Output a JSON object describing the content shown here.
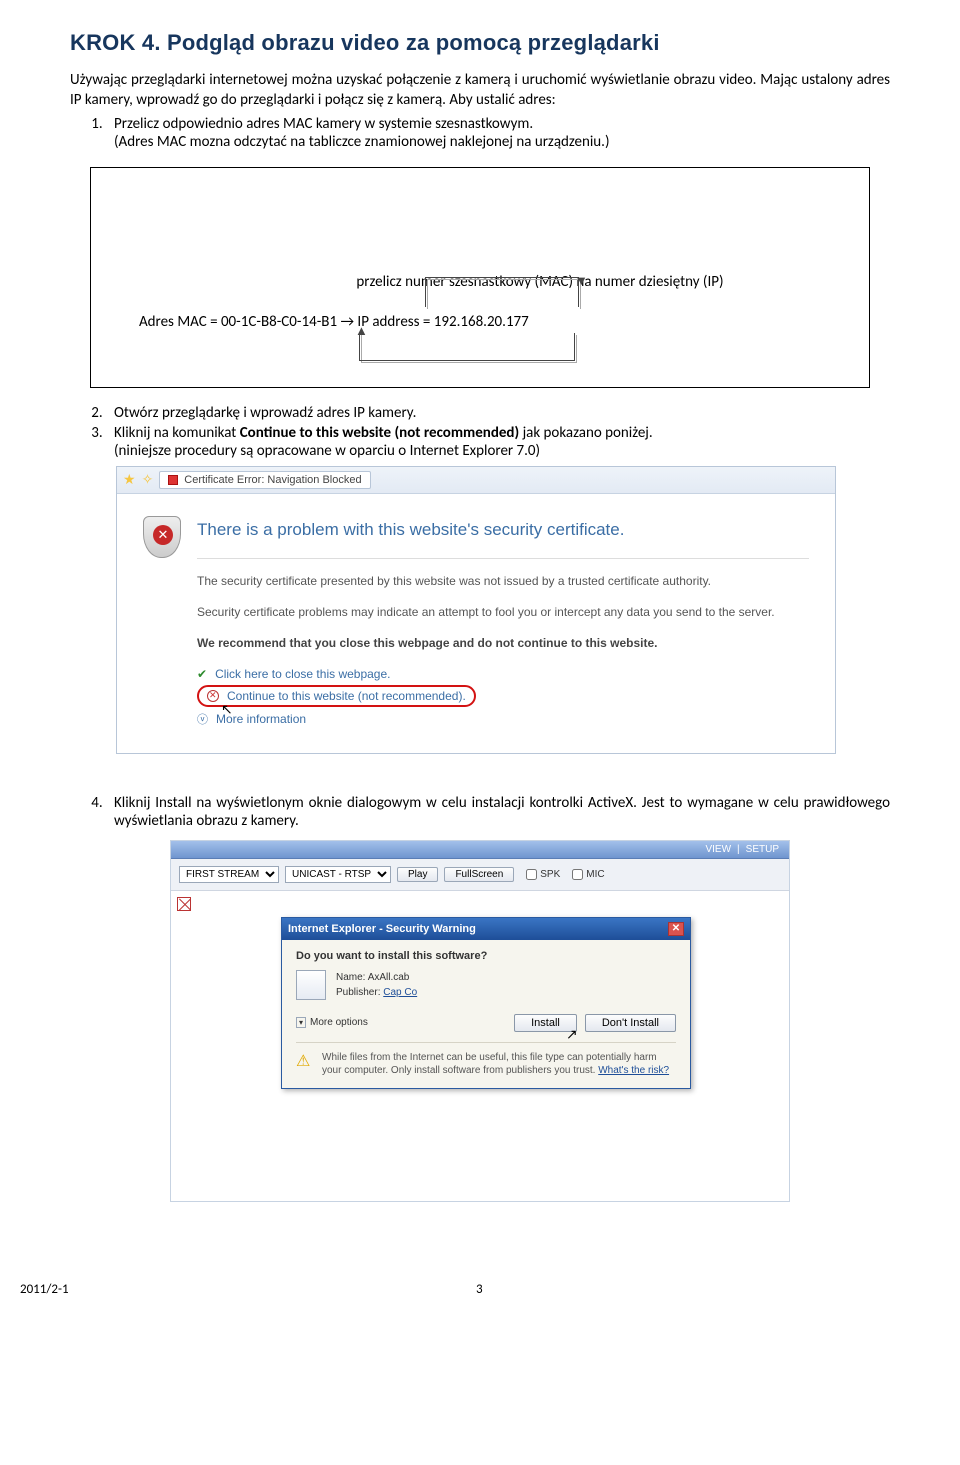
{
  "step_title": "KROK 4.  Podgląd obrazu video za pomocą przeglądarki",
  "intro": "Używając przeglądarki internetowej można uzyskać połączenie z kamerą i uruchomić wyświetlanie obrazu video. Mając ustalony adres IP kamery, wprowadź go do przeglądarki i połącz się z kamerą. Aby ustalić adres:",
  "step1_a": "Przelicz odpowiednio adres MAC kamery w systemie szesnastkowym.",
  "step1_b": "(Adres MAC mozna odczytać na tabliczce znamionowej naklejonej na urządzeniu.)",
  "mac_line": "Adres MAC   =  00-1C-B8-C0-14-B1 → IP address = 192.168.20.177",
  "mac_caption": "przelicz numer szesnastkowy (MAC) na numer dziesiętny (IP)",
  "step2": "Otwórz przeglądarkę i wprowadź adres IP kamery.",
  "step3_a": "Kliknij na komunikat ",
  "step3_bold": "Continue to this website (not recommended)",
  "step3_b": " jak pokazano poniżej.",
  "step3_c": "(niniejsze procedury są opracowane w oparciu o Internet Explorer 7.0)",
  "ie": {
    "tab_label": "Certificate Error: Navigation Blocked",
    "heading": "There is a problem with this website's security certificate.",
    "p1": "The security certificate presented by this website was not issued by a trusted certificate authority.",
    "p2": "Security certificate problems may indicate an attempt to fool you or intercept any data you send to the server.",
    "p3": "We recommend that you close this webpage and do not continue to this website.",
    "link_close": "Click here to close this webpage.",
    "link_continue": "Continue to this website (not recommended).",
    "link_more": "More information"
  },
  "step4": "Kliknij Install na wyświetlonym oknie dialogowym w celu instalacji kontrolki ActiveX. Jest to wymagane w celu prawidłowego wyświetlania obrazu z kamery.",
  "viewer": {
    "nav_view": "VIEW",
    "nav_setup": "SETUP",
    "sel_stream": "FIRST STREAM",
    "sel_cast": "UNICAST - RTSP",
    "btn_play": "Play",
    "btn_full": "FullScreen",
    "chk_spk": "SPK",
    "chk_mic": "MIC"
  },
  "dlg": {
    "title": "Internet Explorer - Security Warning",
    "question": "Do you want to install this software?",
    "name_lbl": "Name:",
    "name_val": "AxAll.cab",
    "pub_lbl": "Publisher:",
    "pub_val": "Cap Co",
    "more": "More options",
    "install": "Install",
    "dont": "Don't Install",
    "warn": "While files from the Internet can be useful, this file type can potentially harm your computer. Only install software from publishers you trust. ",
    "risk": "What's the risk?"
  },
  "footer_left": "2011/2-1",
  "footer_center": "3"
}
